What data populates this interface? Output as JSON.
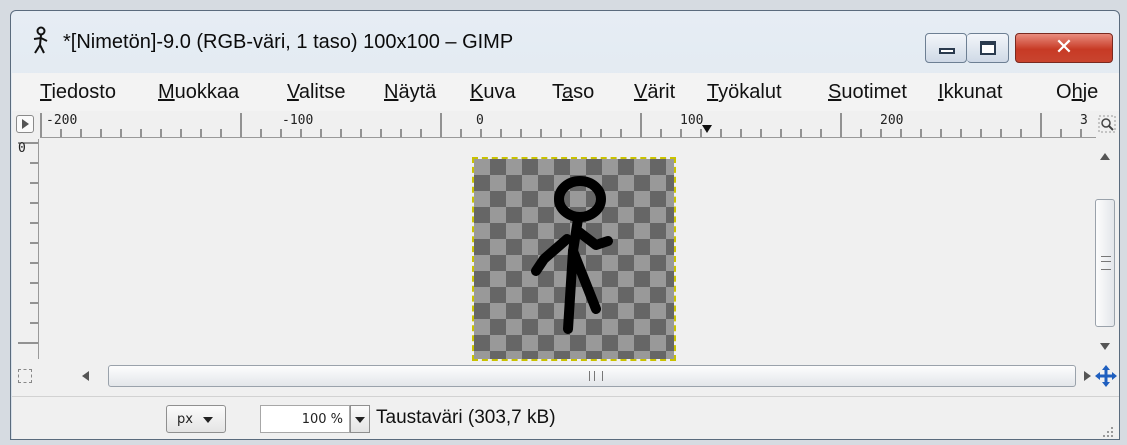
{
  "window": {
    "title": "*[Nimetön]-9.0 (RGB-väri, 1 taso) 100x100 – GIMP"
  },
  "menubar": {
    "items": [
      {
        "mnemonic": "T",
        "rest": "iedosto"
      },
      {
        "mnemonic": "M",
        "rest": "uokkaa"
      },
      {
        "mnemonic": "V",
        "rest": "alitse"
      },
      {
        "mnemonic": "N",
        "rest": "äytä"
      },
      {
        "mnemonic": "K",
        "rest": "uva"
      },
      {
        "pre": "T",
        "mnemonic": "a",
        "rest": "so"
      },
      {
        "mnemonic": "V",
        "rest": "ärit"
      },
      {
        "mnemonic": "T",
        "rest": "yökalut"
      },
      {
        "mnemonic": "S",
        "rest": "uotimet"
      },
      {
        "mnemonic": "I",
        "rest": "kkunat"
      },
      {
        "pre": "O",
        "mnemonic": "h",
        "rest": "je"
      }
    ]
  },
  "rulers": {
    "horizontal_labels": [
      "-200",
      "-100",
      "0",
      "100",
      "200",
      "3"
    ],
    "vertical_label": "0"
  },
  "statusbar": {
    "unit": "px",
    "zoom": "100 %",
    "info": "Taustaväri (303,7 kB)"
  },
  "icons": {
    "app": "gimp-stickman-icon",
    "nav_toggle": "navigation-menu-icon",
    "zoom_corner": "zoom-image-icon",
    "quick_mask": "quick-mask-icon",
    "navigate": "navigate-move-icon"
  }
}
